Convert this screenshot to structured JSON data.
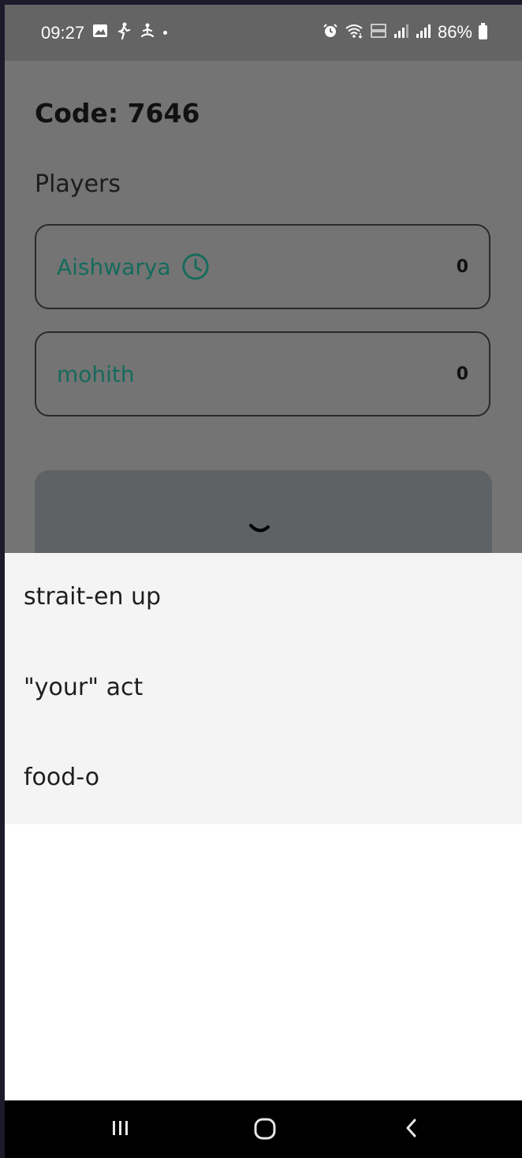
{
  "status_bar": {
    "time": "09:27",
    "battery": "86%",
    "icons_left": [
      "image-icon",
      "walking-icon",
      "meditation-icon",
      "dot-icon"
    ],
    "icons_right": [
      "alarm-icon",
      "wifi-icon",
      "volte-icon",
      "signal-icon",
      "signal-icon",
      "battery-icon"
    ]
  },
  "game": {
    "code_label": "Code: 7646",
    "players_heading": "Players",
    "players": [
      {
        "name": "Aishwarya",
        "score": "0",
        "has_timer": true
      },
      {
        "name": "mohith",
        "score": "0",
        "has_timer": false
      }
    ],
    "accent_color": "#156b5c"
  },
  "sheet": {
    "options": [
      "strait-en up",
      "\"your\" act",
      "food-o"
    ]
  },
  "nav_bar": {
    "buttons": [
      "recents-icon",
      "home-icon",
      "back-icon"
    ]
  }
}
